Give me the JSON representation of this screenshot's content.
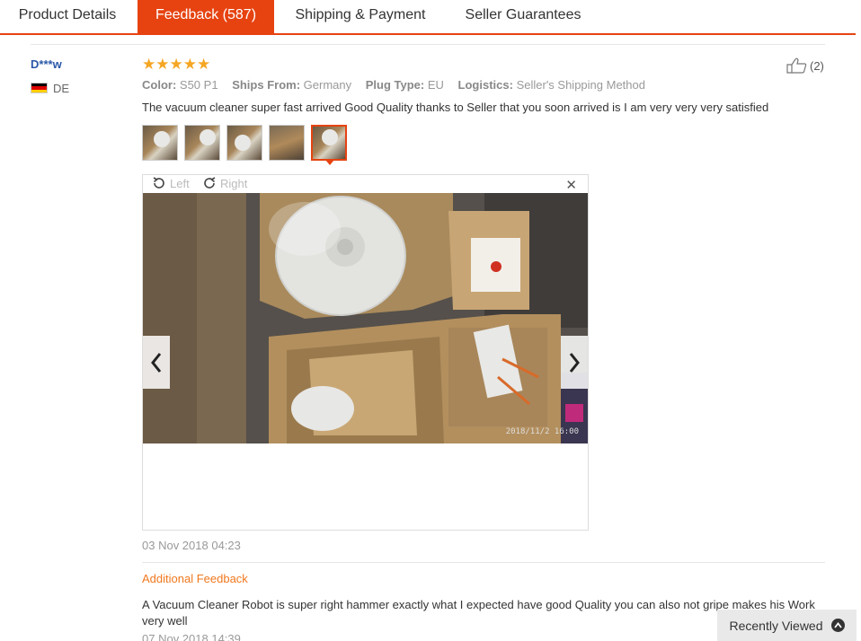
{
  "tabs": [
    {
      "label": "Product Details",
      "active": false
    },
    {
      "label": "Feedback (587)",
      "active": true
    },
    {
      "label": "Shipping & Payment",
      "active": false
    },
    {
      "label": "Seller Guarantees",
      "active": false
    }
  ],
  "reviewer": {
    "name": "D***w",
    "country": "DE",
    "flag_colors": [
      "#000000",
      "#dd0000",
      "#ffce00"
    ]
  },
  "review": {
    "rating": 5,
    "stars": "★★★★★",
    "helpful_count": "(2)",
    "attributes": [
      {
        "label": "Color:",
        "value": "S50 P1"
      },
      {
        "label": "Ships From:",
        "value": "Germany"
      },
      {
        "label": "Plug Type:",
        "value": "EU"
      },
      {
        "label": "Logistics:",
        "value": "Seller's Shipping Method"
      }
    ],
    "text": "The vacuum cleaner super fast arrived Good Quality thanks to Seller that you soon arrived is I am very very very satisfied",
    "date": "03 Nov 2018 04:23",
    "thumbnail_count": 5,
    "active_thumbnail": 5
  },
  "viewer": {
    "rotate_left": "Left",
    "rotate_right": "Right",
    "close_icon": "✕",
    "timestamp": "2018/11/2  16:00"
  },
  "additional": {
    "title": "Additional Feedback",
    "text": "A Vacuum Cleaner Robot is super right hammer exactly what I expected have good Quality you can also not gripe makes his Work very well",
    "date": "07 Nov 2018 14:39"
  },
  "recently_viewed": {
    "label": "Recently Viewed"
  },
  "colors": {
    "accent": "#e64311",
    "star": "#f5a623",
    "link": "#2a58a8",
    "additional": "#f0781e"
  }
}
